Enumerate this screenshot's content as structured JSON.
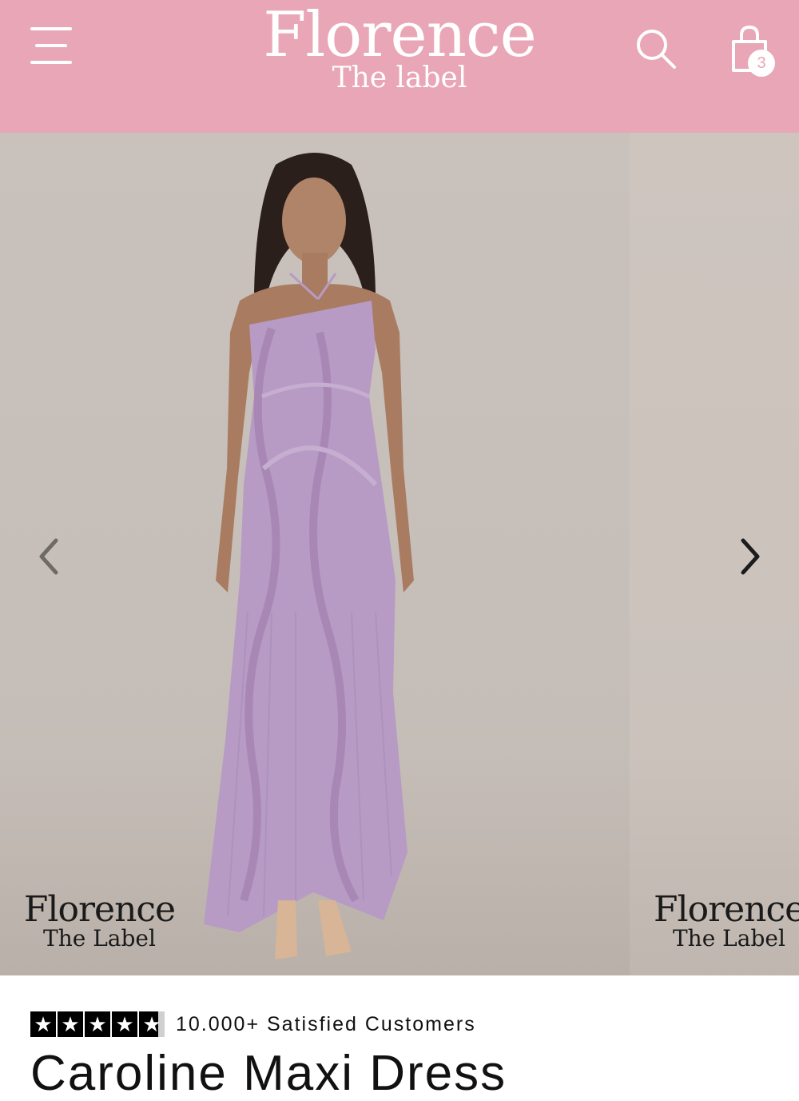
{
  "header": {
    "brand_main": "Florence",
    "brand_sub": "The label",
    "cart_count": "3",
    "menu_icon": "hamburger-icon",
    "search_icon": "search-icon",
    "cart_icon": "shopping-bag-icon",
    "background": "#e8a6b6"
  },
  "carousel": {
    "watermark_main": "Florence",
    "watermark_sub": "The Label",
    "prev_icon": "chevron-left-icon",
    "next_icon": "chevron-right-icon",
    "dress_color": "#b79bc4"
  },
  "product": {
    "rating_stars": 4.75,
    "reviews_text": "10.000+ Satisfied Customers",
    "title": "Caroline Maxi Dress"
  }
}
